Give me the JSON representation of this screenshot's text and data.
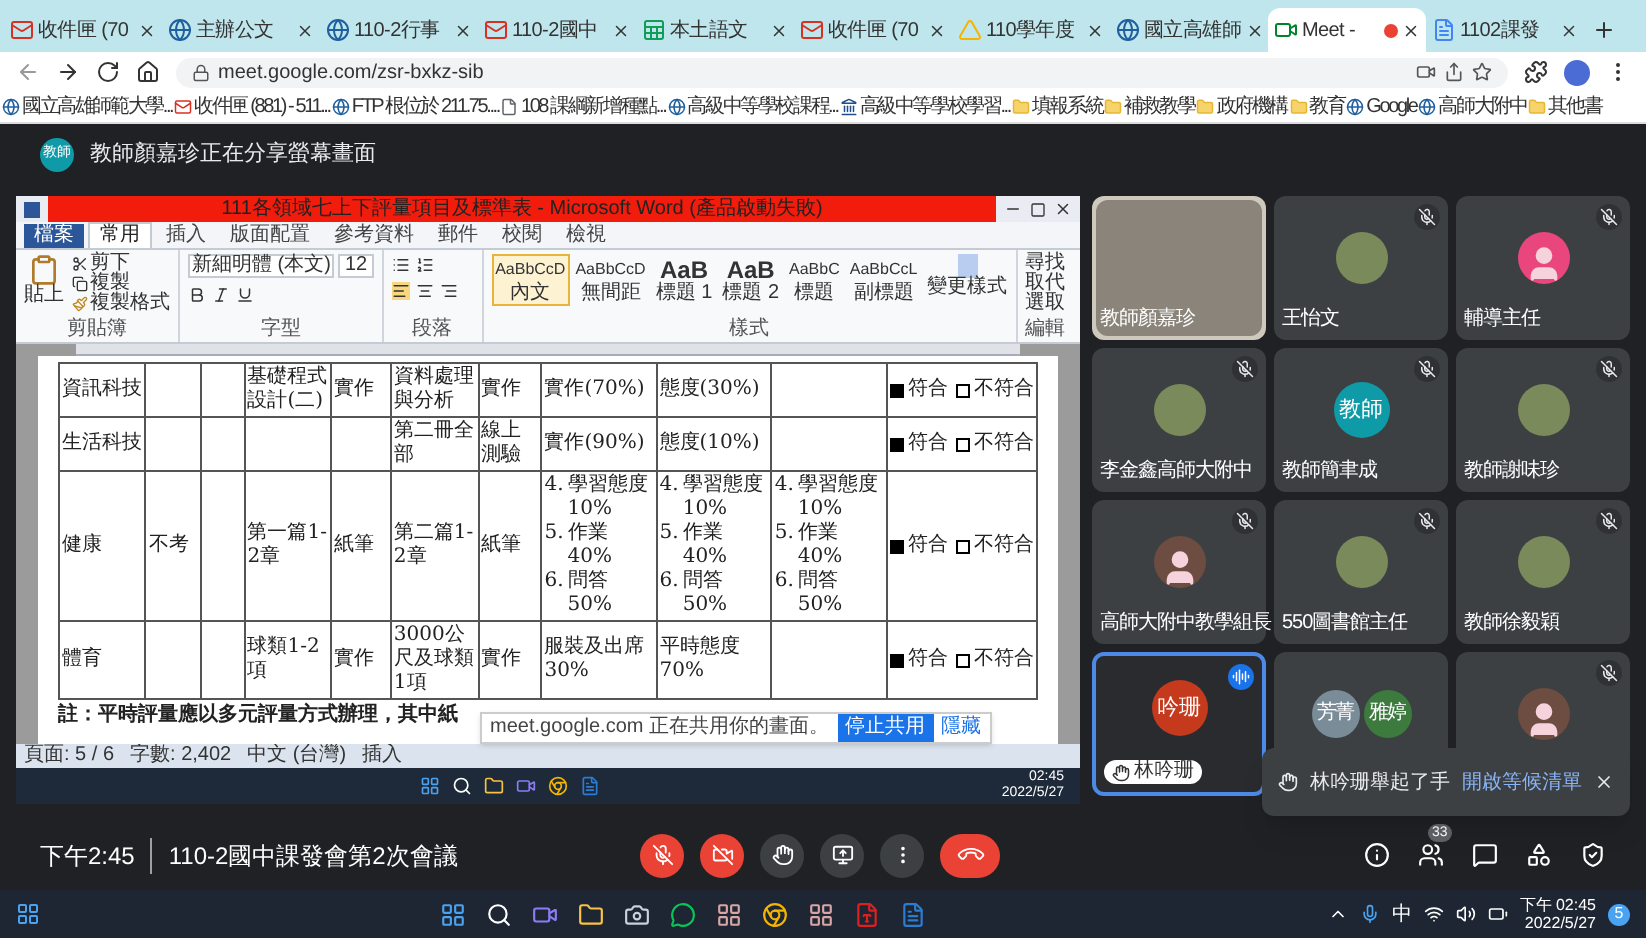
{
  "browser": {
    "tabs": [
      {
        "title": "收件匣 (70",
        "kind": "mail",
        "selected": false,
        "recording": false
      },
      {
        "title": "主辦公文",
        "kind": "site",
        "selected": false,
        "recording": false
      },
      {
        "title": "110-2行事",
        "kind": "site",
        "selected": false,
        "recording": false
      },
      {
        "title": "110-2國中",
        "kind": "mail",
        "selected": false,
        "recording": false
      },
      {
        "title": "本土語文",
        "kind": "sheet",
        "selected": false,
        "recording": false
      },
      {
        "title": "收件匣 (70",
        "kind": "mail",
        "selected": false,
        "recording": false
      },
      {
        "title": "110學年度",
        "kind": "drive",
        "selected": false,
        "recording": false
      },
      {
        "title": "國立高雄師",
        "kind": "site",
        "selected": false,
        "recording": false
      },
      {
        "title": "Meet -",
        "kind": "meet",
        "selected": true,
        "recording": true
      },
      {
        "title": "1102課發",
        "kind": "doc",
        "selected": false,
        "recording": false
      }
    ],
    "address": "meet.google.com/zsr-bxkz-sib",
    "bookmarks": [
      {
        "label": "國立高雄師範大學...",
        "kind": "site"
      },
      {
        "label": "收件匣 (881) - 511...",
        "kind": "mail"
      },
      {
        "label": "FTP 根位於 211.75....",
        "kind": "site"
      },
      {
        "label": "108 課綱新增種點...",
        "kind": "page"
      },
      {
        "label": "高級中等學校課程...",
        "kind": "site"
      },
      {
        "label": "高級中等學校學習...",
        "kind": "bank"
      },
      {
        "label": "填報系統",
        "kind": "folder"
      },
      {
        "label": "補救教學",
        "kind": "folder"
      },
      {
        "label": "政府機構",
        "kind": "folder"
      },
      {
        "label": "教育",
        "kind": "folder"
      },
      {
        "label": "Google",
        "kind": "site"
      },
      {
        "label": "高師大附中",
        "kind": "site"
      },
      {
        "label": "其他書",
        "kind": "folder"
      }
    ]
  },
  "meet": {
    "presenter": {
      "initials": "教師",
      "text": "教師顏嘉珍正在分享螢幕畫面"
    },
    "shared_screen": {
      "word": {
        "title": "111各領域七上下評量項目及標準表 - Microsoft Word (產品啟動失敗)",
        "ribbon_tabs": [
          {
            "label": "檔案",
            "kind": "file",
            "selected": false
          },
          {
            "label": "常用",
            "kind": "tab",
            "selected": true
          },
          {
            "label": "插入",
            "kind": "tab",
            "selected": false
          },
          {
            "label": "版面配置",
            "kind": "tab",
            "selected": false
          },
          {
            "label": "參考資料",
            "kind": "tab",
            "selected": false
          },
          {
            "label": "郵件",
            "kind": "tab",
            "selected": false
          },
          {
            "label": "校閱",
            "kind": "tab",
            "selected": false
          },
          {
            "label": "檢視",
            "kind": "tab",
            "selected": false
          }
        ],
        "clipboard": {
          "paste": "貼上",
          "items": [
            "剪下",
            "複製",
            "複製格式"
          ],
          "group": "剪貼簿"
        },
        "font": {
          "name": "新細明體 (本文)",
          "size": "12",
          "group": "字型"
        },
        "paragraph": {
          "group": "段落"
        },
        "styles": {
          "group": "樣式",
          "change": "變更樣式",
          "items": [
            {
              "sample": "AaBbCcD",
              "name": "內文",
              "selected": true
            },
            {
              "sample": "AaBbCcD",
              "name": "無間距",
              "selected": false
            },
            {
              "sample": "AaB",
              "name": "標題 1",
              "selected": false
            },
            {
              "sample": "AaB",
              "name": "標題 2",
              "selected": false
            },
            {
              "sample": "AaBbC",
              "name": "標題",
              "selected": false
            },
            {
              "sample": "AaBbCcL",
              "name": "副標題",
              "selected": false
            }
          ]
        },
        "editing": {
          "group": "編輯",
          "items": [
            "尋找",
            "取代",
            "選取"
          ]
        },
        "table": {
          "rows": [
            {
              "cells": [
                {
                  "kind": "text",
                  "text": "資訊科技"
                },
                {
                  "kind": "empty"
                },
                {
                  "kind": "empty"
                },
                {
                  "kind": "text",
                  "text": "基礎程式設計(二)"
                },
                {
                  "kind": "text",
                  "text": "實作"
                },
                {
                  "kind": "text",
                  "text": "資料處理與分析"
                },
                {
                  "kind": "text",
                  "text": "實作"
                },
                {
                  "kind": "text",
                  "text": "實作(70%)"
                },
                {
                  "kind": "text",
                  "text": "態度(30%)"
                },
                {
                  "kind": "empty"
                },
                {
                  "kind": "check",
                  "yes": "符合",
                  "no": "不符合",
                  "compliant": true
                }
              ]
            },
            {
              "cells": [
                {
                  "kind": "text",
                  "text": "生活科技"
                },
                {
                  "kind": "empty"
                },
                {
                  "kind": "empty"
                },
                {
                  "kind": "empty"
                },
                {
                  "kind": "empty"
                },
                {
                  "kind": "text",
                  "text": "第二冊全部"
                },
                {
                  "kind": "text",
                  "text": "線上測驗"
                },
                {
                  "kind": "text",
                  "text": "實作(90%)"
                },
                {
                  "kind": "text",
                  "text": "態度(10%)"
                },
                {
                  "kind": "empty"
                },
                {
                  "kind": "check",
                  "yes": "符合",
                  "no": "不符合",
                  "compliant": true
                }
              ]
            },
            {
              "cells": [
                {
                  "kind": "text",
                  "text": "健康"
                },
                {
                  "kind": "text",
                  "text": "不考"
                },
                {
                  "kind": "empty"
                },
                {
                  "kind": "text",
                  "text": "第一篇1-2章"
                },
                {
                  "kind": "text",
                  "text": "紙筆"
                },
                {
                  "kind": "text",
                  "text": "第二篇1-2章"
                },
                {
                  "kind": "text",
                  "text": "紙筆"
                },
                {
                  "kind": "list",
                  "items": [
                    {
                      "num": "4.",
                      "text": "學習態度 10%"
                    },
                    {
                      "num": "5.",
                      "text": "作業 40%"
                    },
                    {
                      "num": "6.",
                      "text": "問答 50%"
                    }
                  ]
                },
                {
                  "kind": "list",
                  "items": [
                    {
                      "num": "4.",
                      "text": "學習態度 10%"
                    },
                    {
                      "num": "5.",
                      "text": "作業 40%"
                    },
                    {
                      "num": "6.",
                      "text": "問答 50%"
                    }
                  ]
                },
                {
                  "kind": "list",
                  "items": [
                    {
                      "num": "4.",
                      "text": "學習態度 10%"
                    },
                    {
                      "num": "5.",
                      "text": "作業 40%"
                    },
                    {
                      "num": "6.",
                      "text": "問答 50%"
                    }
                  ]
                },
                {
                  "kind": "check",
                  "yes": "符合",
                  "no": "不符合",
                  "compliant": true
                }
              ]
            },
            {
              "cells": [
                {
                  "kind": "text",
                  "text": "體育"
                },
                {
                  "kind": "empty"
                },
                {
                  "kind": "empty"
                },
                {
                  "kind": "text",
                  "text": "球類1-2項"
                },
                {
                  "kind": "text",
                  "text": "實作"
                },
                {
                  "kind": "text",
                  "text": "3000公尺及球類1項"
                },
                {
                  "kind": "text",
                  "text": "實作"
                },
                {
                  "kind": "text",
                  "text": "服裝及出席30%"
                },
                {
                  "kind": "text",
                  "text": "平時態度 70%"
                },
                {
                  "kind": "empty"
                },
                {
                  "kind": "check",
                  "yes": "符合",
                  "no": "不符合",
                  "compliant": true
                }
              ]
            }
          ]
        },
        "note": "註：平時評量應以多元評量方式辦理，其中紙",
        "status": [
          "頁面: 5 / 6",
          "字數: 2,402",
          "中文 (台灣)",
          "插入"
        ]
      },
      "share_banner": {
        "text": "meet.google.com 正在共用你的畫面。",
        "stop": "停止共用",
        "hide": "隱藏"
      },
      "taskbar": {
        "time": "02:45",
        "date": "2022/5/27"
      }
    },
    "participants": [
      {
        "name": "教師顏嘉珍",
        "kind": "video",
        "muted": false,
        "speaking": false,
        "hand_raised": false
      },
      {
        "name": "王怡文",
        "kind": "photo",
        "muted": true,
        "speaking": false,
        "hand_raised": false
      },
      {
        "name": "輔導主任",
        "kind": "default",
        "color": "#e8467c",
        "muted": true,
        "speaking": false,
        "hand_raised": false
      },
      {
        "name": "李金鑫高師大附中",
        "kind": "photo",
        "muted": true,
        "speaking": false,
        "hand_raised": false
      },
      {
        "name": "教師簡聿成",
        "kind": "initials",
        "initials": "教師",
        "color": "#0f9aa8",
        "muted": true,
        "speaking": false,
        "hand_raised": false
      },
      {
        "name": "教師謝味珍",
        "kind": "photo",
        "muted": true,
        "speaking": false,
        "hand_raised": false
      },
      {
        "name": "高師大附中教學組長",
        "kind": "default",
        "color": "#6d4c41",
        "muted": true,
        "speaking": false,
        "hand_raised": false
      },
      {
        "name": "550圖書館主任",
        "kind": "photo",
        "muted": true,
        "speaking": false,
        "hand_raised": false
      },
      {
        "name": "教師徐毅穎",
        "kind": "photo",
        "muted": true,
        "speaking": false,
        "hand_raised": false
      },
      {
        "name": "林吟珊",
        "kind": "initials",
        "initials": "吟珊",
        "color": "#c5391c",
        "muted": false,
        "speaking": true,
        "hand_raised": true
      },
      {
        "kind": "pair",
        "pair": [
          {
            "initials": "芳菁",
            "color": "#7b8c99"
          },
          {
            "initials": "雅婷",
            "color": "#3c7a3e"
          }
        ],
        "muted": false,
        "speaking": false,
        "hand_raised": false
      },
      {
        "kind": "default",
        "color": "#6d4c41",
        "muted": true,
        "speaking": false,
        "hand_raised": false
      }
    ],
    "toast": {
      "text": "林吟珊舉起了手",
      "action": "開啟等候清單"
    },
    "bottom_bar": {
      "time": "下午2:45",
      "meeting": "110-2國中課發會第2次會議",
      "controls": [
        {
          "kind": "mic",
          "on": false
        },
        {
          "kind": "camera",
          "on": false
        },
        {
          "kind": "hand"
        },
        {
          "kind": "present"
        },
        {
          "kind": "more"
        },
        {
          "kind": "leave"
        }
      ],
      "side": [
        {
          "kind": "info"
        },
        {
          "kind": "people",
          "badge": "33"
        },
        {
          "kind": "chat"
        },
        {
          "kind": "activities"
        },
        {
          "kind": "host"
        }
      ]
    }
  },
  "taskbar": {
    "apps": [
      {
        "kind": "search"
      },
      {
        "kind": "chat"
      },
      {
        "kind": "folder"
      },
      {
        "kind": "camera"
      },
      {
        "kind": "line"
      },
      {
        "kind": "app"
      },
      {
        "kind": "chrome"
      },
      {
        "kind": "app"
      },
      {
        "kind": "pdf"
      },
      {
        "kind": "word"
      }
    ],
    "ime": "中",
    "time": "下午 02:45",
    "date": "2022/5/27",
    "badge": "5"
  }
}
